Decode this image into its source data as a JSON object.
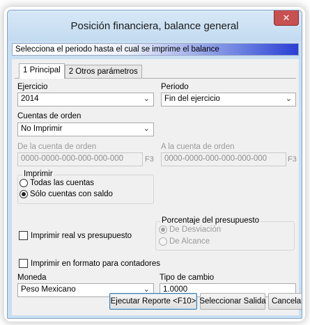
{
  "window": {
    "title": "Posición financiera, balance general",
    "close_glyph": "✕"
  },
  "banner": {
    "text": "Selecciona el periodo hasta el cual se imprime el balance"
  },
  "tabs": [
    {
      "label": "1 Principal",
      "active": true
    },
    {
      "label": "2 Otros parámetros",
      "active": false
    }
  ],
  "form": {
    "ejercicio": {
      "label": "Ejercicio",
      "value": "2014"
    },
    "periodo": {
      "label": "Periodo",
      "value": "Fin del ejercicio"
    },
    "cuentas_orden": {
      "label": "Cuentas de orden",
      "value": "No Imprimir"
    },
    "de_cuenta": {
      "label": "De la cuenta de orden",
      "value": "0000-0000-000-000-000-000",
      "key_hint": "F3"
    },
    "a_cuenta": {
      "label": "A la cuenta de orden",
      "value": "0000-0000-000-000-000-000",
      "key_hint": "F3"
    },
    "imprimir": {
      "title": "Imprimir",
      "options": [
        {
          "label": "Todas las cuentas",
          "selected": false
        },
        {
          "label": "Sólo cuentas con saldo",
          "selected": true
        }
      ]
    },
    "real_vs_presupuesto": {
      "label": "Imprimir real vs presupuesto",
      "checked": false
    },
    "porcentaje": {
      "title": "Porcentaje del presupuesto",
      "options": [
        {
          "label": "De Desviación",
          "selected": true
        },
        {
          "label": "De Alcance",
          "selected": false
        }
      ]
    },
    "formato_contadores": {
      "label": "Imprimir en formato para contadores",
      "checked": false
    },
    "moneda": {
      "label": "Moneda",
      "value": "Peso Mexicano"
    },
    "tipo_cambio": {
      "label": "Tipo de cambio",
      "value": "1.0000"
    }
  },
  "buttons": {
    "ejecutar": "Ejecutar Reporte <F10>",
    "seleccionar": "Seleccionar Salida",
    "cancelar": "Cancelar"
  },
  "icons": {
    "chevron": "chevron-down-icon",
    "close": "close-icon"
  },
  "colors": {
    "close_button": "#c75050",
    "banner_end": "#2a3fd4",
    "window_frame": "#c8dff2"
  }
}
